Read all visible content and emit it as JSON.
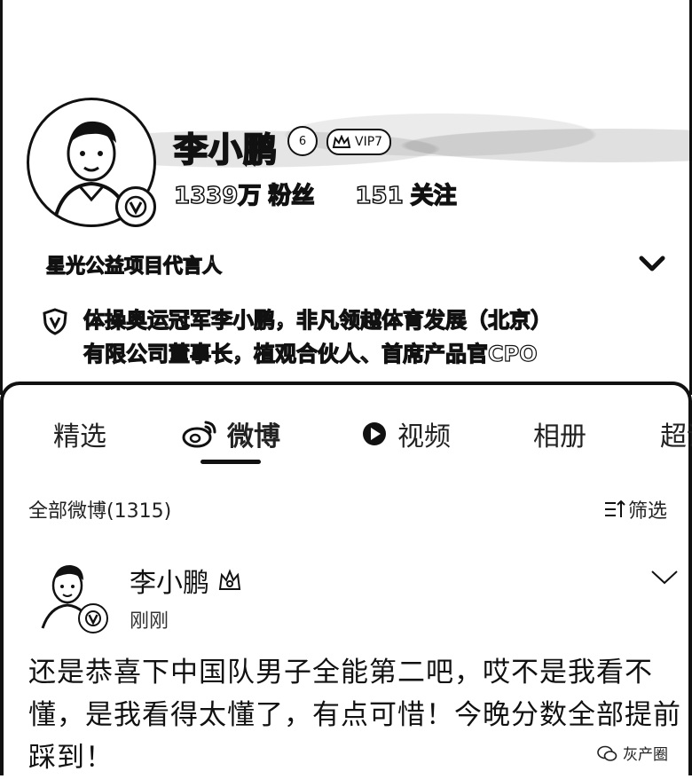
{
  "profile": {
    "name": "李小鹏",
    "level": "6",
    "vip": "VIP7",
    "followers_count": "1339万",
    "followers_label": "粉丝",
    "following_count": "151",
    "following_label": "关注",
    "ambassador": "星光公益项目代言人",
    "bio_line1": "体操奥运冠军李小鹏，非凡领越体育发展（北京）",
    "bio_line2": "有限公司董事长，植观合伙人、首席产品官CPO"
  },
  "tabs": [
    {
      "label": "精选"
    },
    {
      "label": "微博"
    },
    {
      "label": "视频"
    },
    {
      "label": "相册"
    },
    {
      "label": "超话"
    }
  ],
  "filter": {
    "all_label": "全部微博(1315)",
    "filter_label": "筛选"
  },
  "post": {
    "author": "李小鹏",
    "time": "刚刚",
    "text": "还是恭喜下中国队男子全能第二吧，哎不是我看不懂，是我看得太懂了，有点可惜！今晚分数全部提前踩到！"
  },
  "watermark": "灰产圈"
}
